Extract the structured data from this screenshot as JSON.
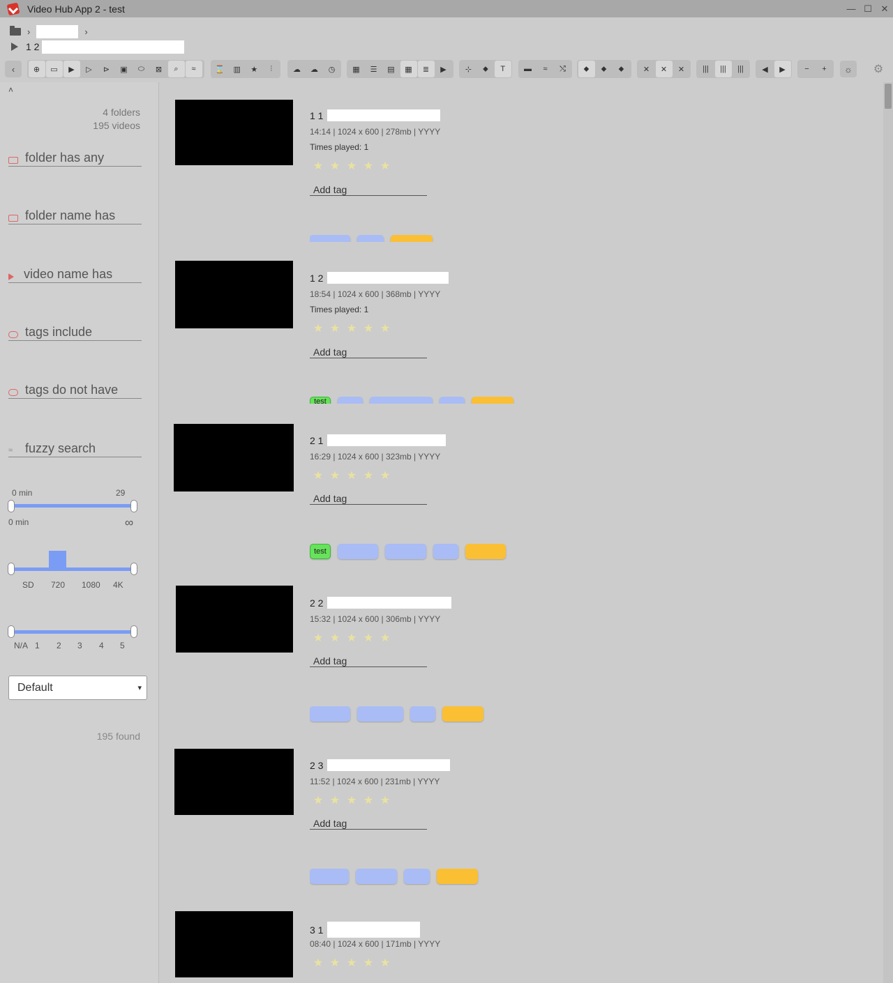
{
  "window": {
    "title": "Video Hub App 2 - test",
    "controls": [
      "—",
      "☐",
      "✕"
    ]
  },
  "breadcrumb": {
    "chevron": "›",
    "current_folder": "1 2"
  },
  "toolbar": {
    "back": "‹",
    "group1": [
      "⊕",
      "▭",
      "▶",
      "▷",
      "⊳",
      "▣",
      "⬭",
      "⊠",
      "⌕",
      "≈"
    ],
    "group2": [
      "⌛",
      "▥",
      "★",
      "⫶"
    ],
    "group3": [
      "☁",
      "☁",
      "◷"
    ],
    "group4": [
      "▦",
      "☰",
      "▤",
      "▦",
      "≣",
      "▶"
    ],
    "group5": [
      "⊹",
      "⬥",
      "T"
    ],
    "group6": [
      "▬",
      "≈",
      "⤭"
    ],
    "group7": [
      "⬥",
      "⬥",
      "⬥"
    ],
    "group8": [
      "✕",
      "✕",
      "✕"
    ],
    "group9": [
      "|||",
      "|||",
      "|||"
    ],
    "group10": [
      "◀",
      "▶"
    ],
    "zoom_out": "−",
    "zoom_in": "+",
    "theme": "☼",
    "settings": "⚙"
  },
  "sidebar": {
    "collapse": "˄",
    "folders_count": "4 folders",
    "videos_count": "195 videos",
    "filters": [
      "folder has any",
      "folder name has",
      "video name has",
      "tags include",
      "tags do not have",
      "fuzzy search"
    ],
    "duration": {
      "min_label": "0 min",
      "max_label": "29 min",
      "lower": "0 min",
      "upper": "∞"
    },
    "resolution_labels": [
      "SD",
      "720",
      "1080",
      "4K"
    ],
    "rating_labels": [
      "N/A",
      "1",
      "2",
      "3",
      "4",
      "5"
    ],
    "sort_value": "Default",
    "sort_arrow": "▾",
    "found": "195 found"
  },
  "videos": [
    {
      "title": "1 1",
      "meta": "14:14 | 1024 x 600 | 278mb | YYYY",
      "played": "Times played: 1",
      "add_tag": "Add tag",
      "tags": [
        "",
        "",
        ""
      ]
    },
    {
      "title": "1 2",
      "meta": "18:54 | 1024 x 600 | 368mb | YYYY",
      "played": "Times played: 1",
      "add_tag": "Add tag",
      "tags": [
        "test",
        "",
        "",
        "",
        ""
      ]
    },
    {
      "title": "2 1",
      "meta": "16:29 | 1024 x 600 | 323mb | YYYY",
      "played": "",
      "add_tag": "Add tag",
      "tags": [
        "test",
        "",
        "",
        "",
        ""
      ]
    },
    {
      "title": "2 2",
      "meta": "15:32 | 1024 x 600 | 306mb | YYYY",
      "played": "",
      "add_tag": "Add tag",
      "tags": [
        "",
        "",
        "",
        ""
      ]
    },
    {
      "title": "2 3",
      "meta": "11:52 | 1024 x 600 | 231mb | YYYY",
      "played": "",
      "add_tag": "Add tag",
      "tags": [
        "",
        "",
        "",
        ""
      ]
    },
    {
      "title": "3 1",
      "meta": "08:40 | 1024 x 600 | 171mb | YYYY",
      "played": "",
      "add_tag": "",
      "tags": []
    }
  ],
  "star_glyph": "★"
}
